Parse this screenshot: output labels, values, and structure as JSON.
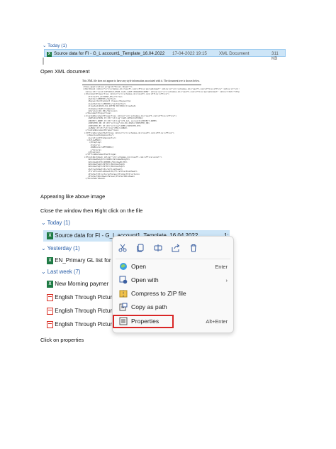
{
  "explorer1": {
    "group": "Today (1)",
    "row": {
      "name": "Source data for FI - G_L account1_Template_16.04.2022",
      "date": "17-04-2022 19:15",
      "type": "XML Document",
      "size": "311 KB"
    }
  },
  "paragraphs": {
    "open_xml": "Open XML document",
    "appearing": "Appearing like above image",
    "close_window": "Close the window then Right click on the file",
    "click_properties": "Click on properties"
  },
  "xml_doc": {
    "note": "This XML file does not appear to have any style information associated with it. The document tree is shown below."
  },
  "explorer2": {
    "groups": {
      "today": "Today (1)",
      "yesterday": "Yesterday (1)",
      "last_week": "Last week (7)"
    },
    "files": {
      "source": "Source data for FI - G_L account1_Template_16.04.2022",
      "source_size": "1:",
      "en_primary": "EN_Primary GL list for",
      "new_morning": "New Morning paymer",
      "english1": "English Through Pictur",
      "english2": "English Through Pictur",
      "english3": "English Through Pictur"
    }
  },
  "context_menu": {
    "icons": [
      "cut-icon",
      "copy-icon",
      "rename-icon",
      "share-icon",
      "delete-icon"
    ],
    "items": [
      {
        "label": "Open",
        "shortcut": "Enter"
      },
      {
        "label": "Open with",
        "shortcut": "›"
      },
      {
        "label": "Compress to ZIP file",
        "shortcut": ""
      },
      {
        "label": "Copy as path",
        "shortcut": ""
      },
      {
        "label": "Properties",
        "shortcut": "Alt+Enter"
      }
    ],
    "highlight_color": "#d92626"
  }
}
